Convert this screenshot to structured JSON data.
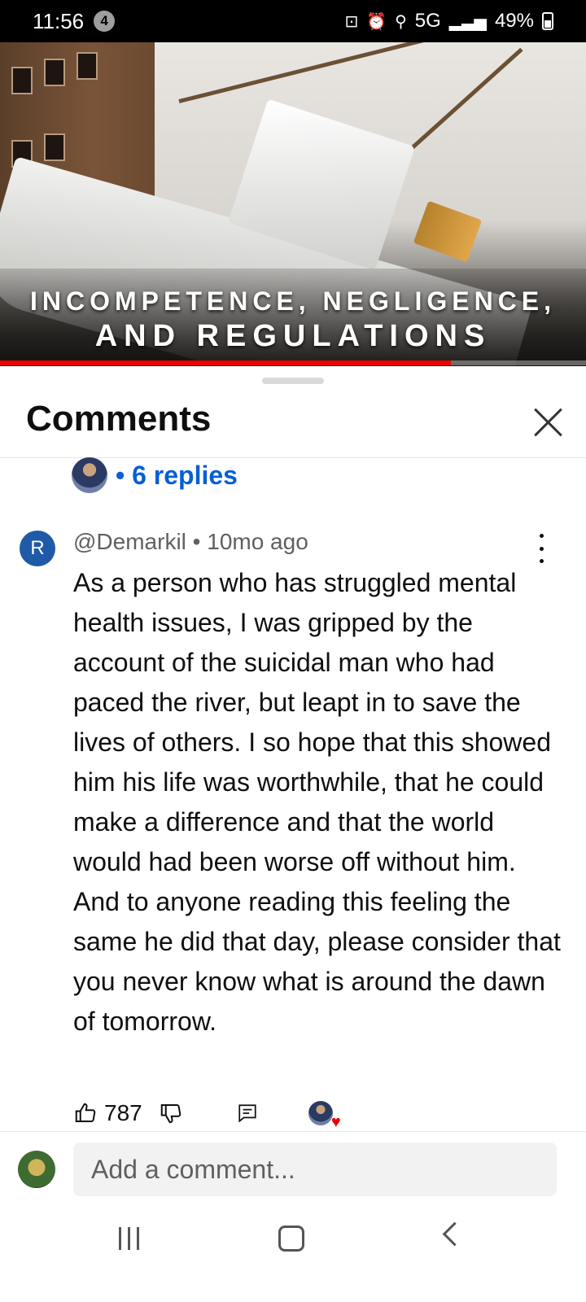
{
  "status_bar": {
    "time": "11:56",
    "notification_count": "4",
    "network": "5G",
    "battery": "49%"
  },
  "video": {
    "title_line1": "INCOMPETENCE, NEGLIGENCE,",
    "title_line2": "AND REGULATIONS",
    "progress": 0.77
  },
  "comments_panel": {
    "title": "Comments",
    "replies_link": "• 6 replies",
    "comment": {
      "avatar_letter": "R",
      "author": "@Demarkil",
      "age": "10mo ago",
      "meta": "@Demarkil • 10mo ago",
      "text": "As a person who has struggled mental health issues, I was gripped by the account of the suicidal man who had paced the river, but leapt in to save the lives of others. I so hope that this showed him his life was worthwhile, that he could make a difference and that the world would had been worse off without him. And to anyone reading this feeling the same he did that day, please consider that you never know what is around the dawn of tomorrow.",
      "likes": "787"
    },
    "composer": {
      "placeholder": "Add a comment..."
    }
  },
  "colors": {
    "link_blue": "#065fd4",
    "progress_red": "#e00000",
    "avatar_blue": "#1e5aa8"
  }
}
